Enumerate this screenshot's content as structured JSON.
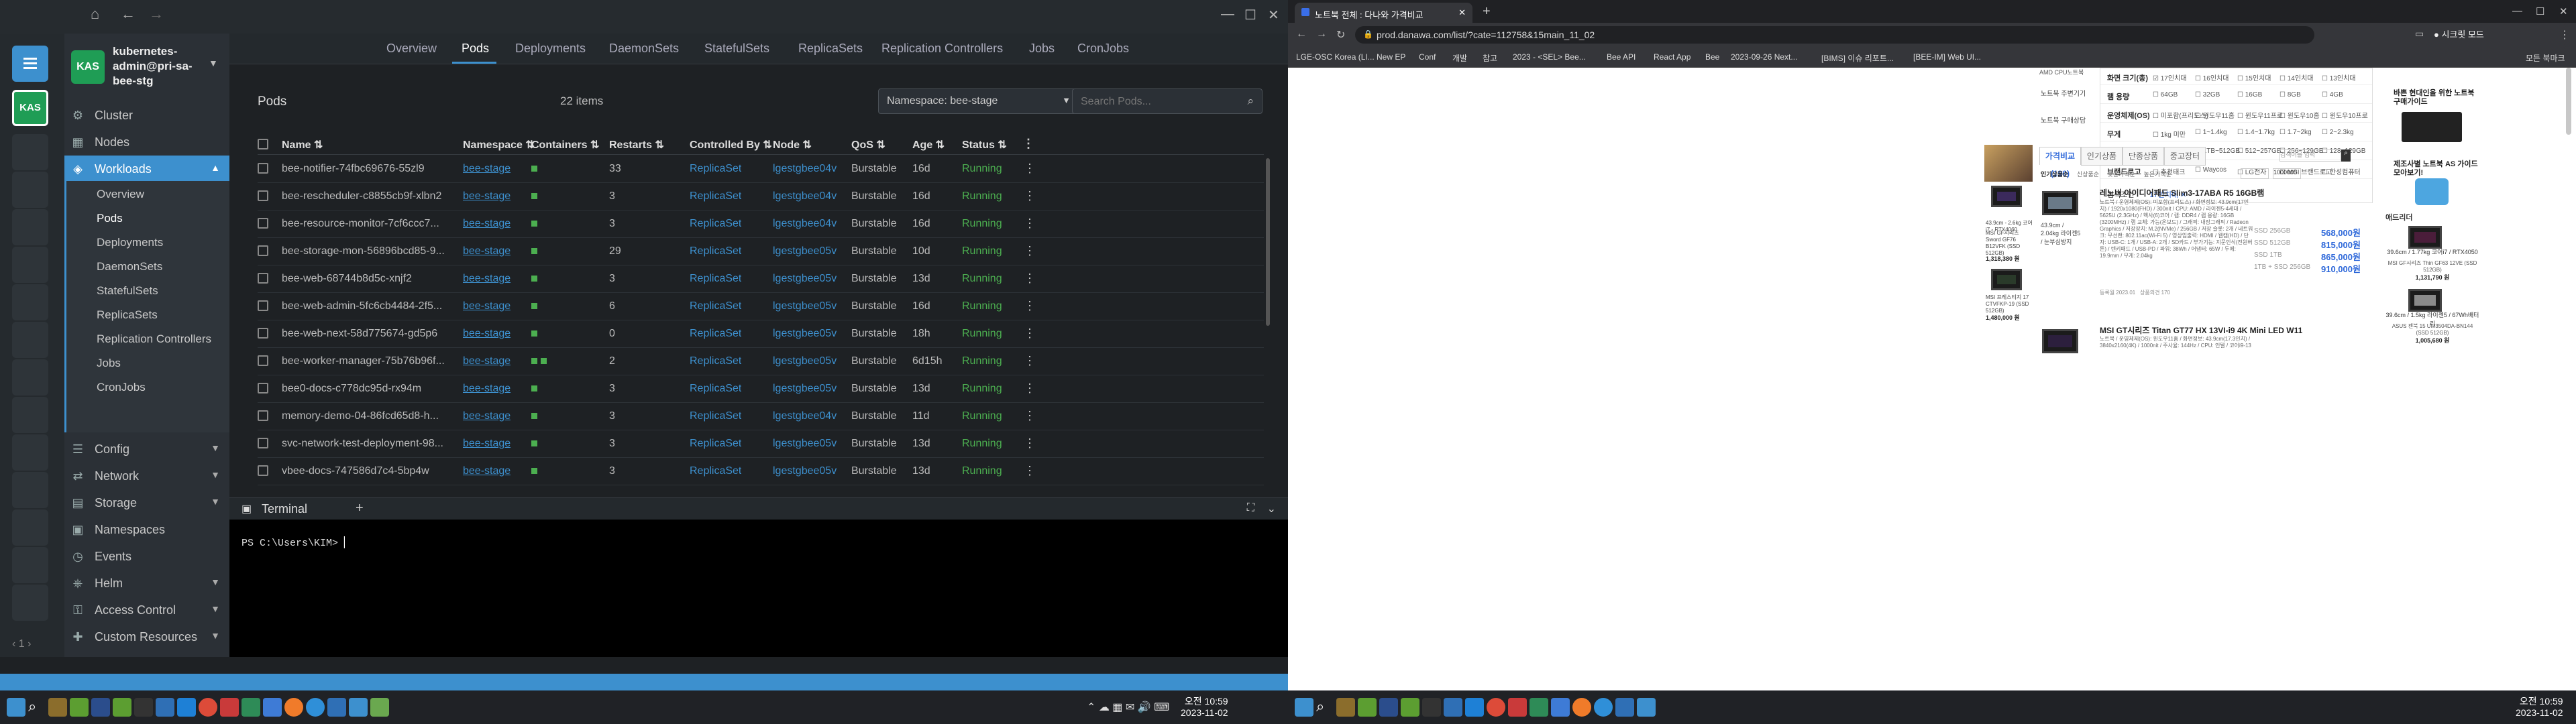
{
  "lens": {
    "cluster": {
      "avatar": "KAS",
      "name": "kubernetes-admin@pri-sa-bee-stg"
    },
    "hotbar": {
      "page": "1"
    },
    "sidebar": {
      "cluster": "Cluster",
      "nodes": "Nodes",
      "workloads": "Workloads",
      "workload_items": [
        "Overview",
        "Pods",
        "Deployments",
        "DaemonSets",
        "StatefulSets",
        "ReplicaSets",
        "Replication Controllers",
        "Jobs",
        "CronJobs"
      ],
      "config": "Config",
      "network": "Network",
      "storage": "Storage",
      "namespaces": "Namespaces",
      "events": "Events",
      "helm": "Helm",
      "access_control": "Access Control",
      "custom_resources": "Custom Resources"
    },
    "tabs": [
      "Overview",
      "Pods",
      "Deployments",
      "DaemonSets",
      "StatefulSets",
      "ReplicaSets",
      "Replication Controllers",
      "Jobs",
      "CronJobs"
    ],
    "active_tab": "Pods",
    "pods": {
      "title": "Pods",
      "count": "22 items",
      "namespace_select": "Namespace: bee-stage",
      "search_placeholder": "Search Pods...",
      "columns": [
        "Name",
        "Namespace",
        "Containers",
        "Restarts",
        "Controlled By",
        "Node",
        "QoS",
        "Age",
        "Status"
      ],
      "rows": [
        {
          "name": "bee-notifier-74fbc69676-55zl9",
          "namespace": "bee-stage",
          "containers": 1,
          "restarts": "33",
          "controlled_by": "ReplicaSet",
          "node": "lgestgbee04v",
          "qos": "Burstable",
          "age": "16d",
          "status": "Running"
        },
        {
          "name": "bee-rescheduler-c8855cb9f-xlbn2",
          "namespace": "bee-stage",
          "containers": 1,
          "restarts": "3",
          "controlled_by": "ReplicaSet",
          "node": "lgestgbee04v",
          "qos": "Burstable",
          "age": "16d",
          "status": "Running"
        },
        {
          "name": "bee-resource-monitor-7cf6ccc7...",
          "namespace": "bee-stage",
          "containers": 1,
          "restarts": "3",
          "controlled_by": "ReplicaSet",
          "node": "lgestgbee04v",
          "qos": "Burstable",
          "age": "16d",
          "status": "Running"
        },
        {
          "name": "bee-storage-mon-56896bcd85-9...",
          "namespace": "bee-stage",
          "containers": 1,
          "restarts": "29",
          "controlled_by": "ReplicaSet",
          "node": "lgestgbee05v",
          "qos": "Burstable",
          "age": "10d",
          "status": "Running"
        },
        {
          "name": "bee-web-68744b8d5c-xnjf2",
          "namespace": "bee-stage",
          "containers": 1,
          "restarts": "3",
          "controlled_by": "ReplicaSet",
          "node": "lgestgbee05v",
          "qos": "Burstable",
          "age": "13d",
          "status": "Running"
        },
        {
          "name": "bee-web-admin-5fc6cb4484-2f5...",
          "namespace": "bee-stage",
          "containers": 1,
          "restarts": "6",
          "controlled_by": "ReplicaSet",
          "node": "lgestgbee05v",
          "qos": "Burstable",
          "age": "16d",
          "status": "Running"
        },
        {
          "name": "bee-web-next-58d775674-gd5p6",
          "namespace": "bee-stage",
          "containers": 1,
          "restarts": "0",
          "controlled_by": "ReplicaSet",
          "node": "lgestgbee05v",
          "qos": "Burstable",
          "age": "18h",
          "status": "Running"
        },
        {
          "name": "bee-worker-manager-75b76b96f...",
          "namespace": "bee-stage",
          "containers": 2,
          "restarts": "2",
          "controlled_by": "ReplicaSet",
          "node": "lgestgbee05v",
          "qos": "Burstable",
          "age": "6d15h",
          "status": "Running"
        },
        {
          "name": "bee0-docs-c778dc95d-rx94m",
          "namespace": "bee-stage",
          "containers": 1,
          "restarts": "3",
          "controlled_by": "ReplicaSet",
          "node": "lgestgbee05v",
          "qos": "Burstable",
          "age": "13d",
          "status": "Running"
        },
        {
          "name": "memory-demo-04-86fcd65d8-h...",
          "namespace": "bee-stage",
          "containers": 1,
          "restarts": "3",
          "controlled_by": "ReplicaSet",
          "node": "lgestgbee04v",
          "qos": "Burstable",
          "age": "11d",
          "status": "Running"
        },
        {
          "name": "svc-network-test-deployment-98...",
          "namespace": "bee-stage",
          "containers": 1,
          "restarts": "3",
          "controlled_by": "ReplicaSet",
          "node": "lgestgbee05v",
          "qos": "Burstable",
          "age": "13d",
          "status": "Running"
        },
        {
          "name": "vbee-docs-747586d7c4-5bp4w",
          "namespace": "bee-stage",
          "containers": 1,
          "restarts": "3",
          "controlled_by": "ReplicaSet",
          "node": "lgestgbee05v",
          "qos": "Burstable",
          "age": "13d",
          "status": "Running"
        }
      ]
    },
    "terminal": {
      "title": "Terminal",
      "prompt": "PS C:\\Users\\KIM> "
    }
  },
  "taskbar_left": {
    "time": "오전 10:59",
    "date": "2023-11-02"
  },
  "chrome": {
    "tab_title": "노트북 전체 : 다나와 가격비교",
    "url": "prod.danawa.com/list/?cate=112758&15main_11_02",
    "profile": "시크릿 모드",
    "bookmarks": [
      "LGE-OSC Korea (LI...",
      "New EP",
      "Conf",
      "개발",
      "참고",
      "2023 - <SEL> Bee...",
      "Bee API",
      "React App",
      "Bee",
      "2023-09-26 Next...",
      "[BIMS] 이슈 리포트...",
      "[BEE-IM] Web UI...",
      "모든 북마크"
    ]
  },
  "danawa": {
    "filters": [
      {
        "label": "화면 크기(총)",
        "opts": [
          "17인치대",
          "16인치대",
          "15인치대",
          "14인치대",
          "13인치대"
        ]
      },
      {
        "label": "램 용량",
        "opts": [
          "64GB",
          "32GB",
          "16GB",
          "8GB",
          "4GB"
        ]
      },
      {
        "label": "운영체제(OS)",
        "opts": [
          "미포함(프리도스)",
          "윈도우11홈",
          "윈도우11프로",
          "윈도우10홈",
          "윈도우10프로"
        ]
      },
      {
        "label": "무게",
        "opts": [
          "1kg 미만",
          "1~1.4kg",
          "1.4~1.7kg",
          "1.7~2kg",
          "2~2.3kg"
        ]
      },
      {
        "label": "저장 용량",
        "opts": [
          "1TB 초과",
          "1TB~512GB",
          "512~257GB",
          "256~129GB",
          "128~129GB"
        ]
      },
      {
        "label": "브랜드로고",
        "opts": [
          "추천태크",
          "Waycos",
          "LG전자",
          "MSI 브랜드로고",
          "한성컴퓨터"
        ]
      }
    ],
    "selected_label": "검색조건",
    "selected_value": "17인치대",
    "left_menu": [
      "AMD CPU노트북",
      "노트북 주변기기",
      "노트북 구매상담"
    ],
    "tabs": [
      "가격비교 (190)",
      "인기상품",
      "단종상품",
      "중고장터"
    ],
    "search_placeholder": "검색어를 입력",
    "sort": [
      "인기상품순",
      "신상품순",
      "낮은가격순",
      "높은가격순",
      "판매량순",
      "상품의견 많은순"
    ],
    "price_from": "",
    "price_to": "1000000",
    "products": [
      {
        "title": "레노버 아이디어패드 Slim3-17ABA R5 16GB램",
        "caption": "43.9cm / 2.04kg 라이젠5 / 눈부심방지",
        "spec": "노트북 / 운영체제(OS): 미포함(프리도스) / 화면정보: 43.9cm(17인치) / 1920x1080(FHD) / 300nit / CPU: AMD / 라이젠5-4세대 / 5625U (2.3GHz) / 헥사(6)코어 / 램: DDR4 / 램 용량: 16GB (3200MHz) / 램 교체: 가능(온보드) / 그래픽: 내장그래픽 / Radeon Graphics / 저장장치: M.2(NVMe) / 256GB / 저장 슬롯: 2개 / 네트워크: 무선랜: 802.11ac(Wi-Fi 5) / 영상입출력: HDMI / 웹캠(HD) / 단자: USB-C: 1개 / USB-A: 2개 / SD카드 / 부가기능: 지문인식(전원버튼) / 텐키패드 / USB-PD / 파워: 38Wh / 어댑터: 65W / 두께: 19.9mm / 무게: 2.04kg",
        "date": "등록월 2023.01",
        "reviews": "상품의견 170",
        "options": [
          {
            "label": "SSD 256GB",
            "price": "568,000원"
          },
          {
            "label": "SSD 512GB",
            "price": "815,000원"
          },
          {
            "label": "SSD 1TB",
            "price": "865,000원"
          },
          {
            "label": "1TB + SSD 256GB",
            "price": "910,000원"
          }
        ]
      },
      {
        "title": "MSI GT시리즈 Titan GT77 HX 13VI-i9 4K Mini LED W11",
        "spec": "노트북 / 운영체제(OS): 윈도우11홈 / 화면정보: 43.9cm(17.3인치) / 3840x2160(4K) / 1000nit / 주사율: 144Hz / CPU: 인텔 / 코어i9-13세대 / i9-13980HX (2.2GHz) / 24코어(8P+16E)"
      }
    ],
    "left_promo": [
      {
        "caption": "43.9cm - 2.6kg 코어i7 - RTX4060",
        "name": "MSI GF시리즈 Sword GF76 B12VFK (SSD 512GB)",
        "price": "1,318,380 원"
      },
      {
        "caption": "",
        "name": "MSI 프레스티지 17 CTVFKP-19 (SSD 512GB)",
        "price": "1,480,000 원"
      }
    ],
    "right_ads": {
      "promo1": "바쁜 현대인을 위한 노트북 구매가이드",
      "promo2": "제조사별 노트북 AS 가이드 모아보기!",
      "title": "애드리더",
      "items": [
        {
          "caption": "39.6cm / 1.77kg 코어i7 / RTX4050",
          "name": "MSI GF시리즈 Thin GF63 12VE (SSD 512GB)",
          "price": "1,131,790 원"
        },
        {
          "caption": "39.6cm / 1.5kg 라이젠5 / 67Wh배터리",
          "name": "ASUS 젠북 15 UM3504DA-BN144 (SSD 512GB)",
          "price": "1,005,680 원"
        }
      ]
    }
  },
  "taskbar_right": {
    "time": "오전 10:59",
    "date": "2023-11-02"
  }
}
